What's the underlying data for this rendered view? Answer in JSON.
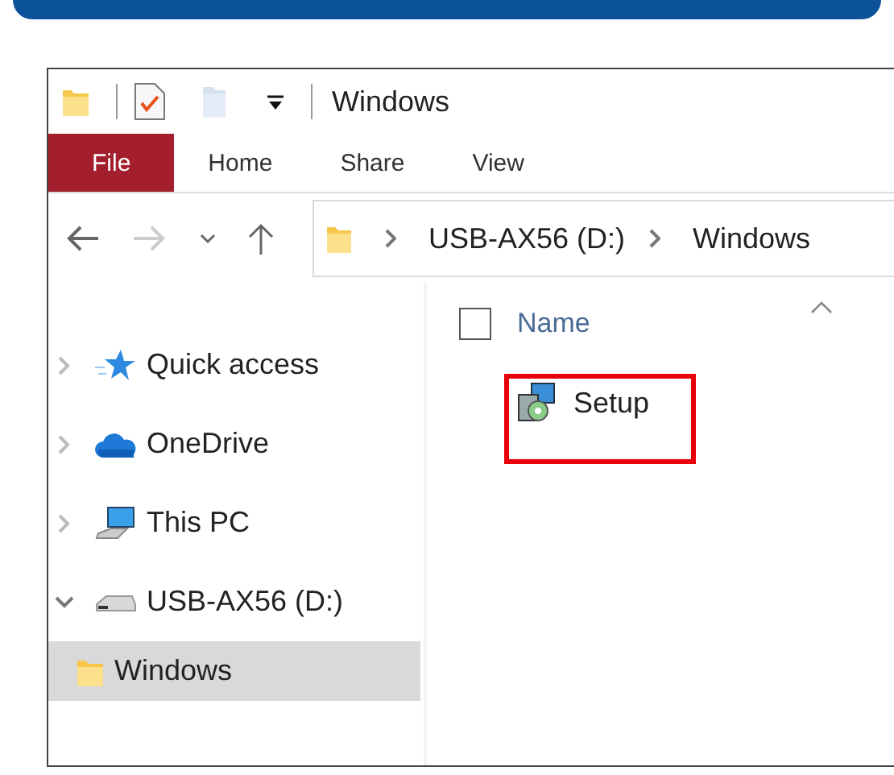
{
  "window": {
    "title": "Windows"
  },
  "ribbon_tabs": [
    {
      "label": "File",
      "selected": true
    },
    {
      "label": "Home",
      "selected": false
    },
    {
      "label": "Share",
      "selected": false
    },
    {
      "label": "View",
      "selected": false
    }
  ],
  "address": {
    "path": [
      "USB-AX56 (D:)",
      "Windows"
    ]
  },
  "navigation": [
    {
      "label": "Quick access",
      "kind": "star",
      "expanded": false,
      "selected": false
    },
    {
      "label": "OneDrive",
      "kind": "cloud",
      "expanded": false,
      "selected": false
    },
    {
      "label": "This PC",
      "kind": "computer",
      "expanded": false,
      "selected": false
    },
    {
      "label": "USB-AX56 (D:)",
      "kind": "drive",
      "expanded": true,
      "selected": false,
      "children": [
        {
          "label": "Windows",
          "kind": "folder",
          "selected": true
        }
      ]
    }
  ],
  "file_list": {
    "columns": [
      {
        "label": "Name",
        "sorted": true
      }
    ],
    "select_all": {
      "checked": false
    },
    "files": [
      {
        "name": "Setup",
        "highlighted": true
      }
    ]
  }
}
